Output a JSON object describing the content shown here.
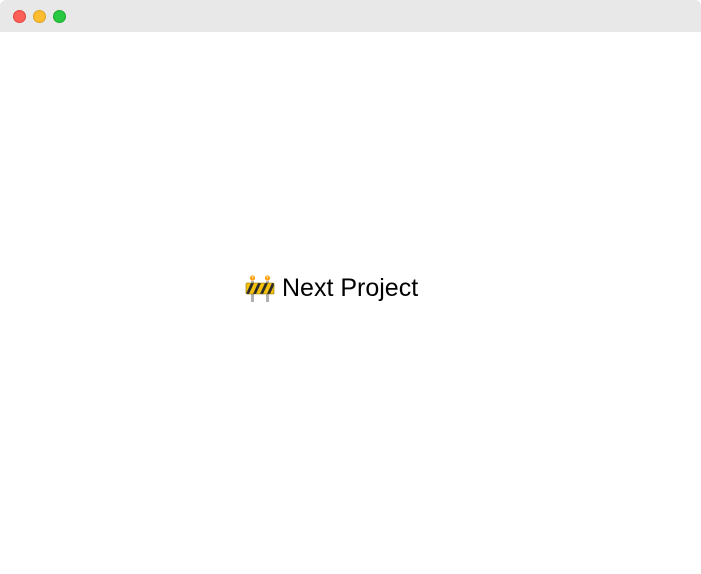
{
  "window": {
    "controls": [
      "close",
      "minimize",
      "maximize"
    ]
  },
  "main": {
    "icon": "construction-barrier-icon",
    "title": "Next Project"
  },
  "colors": {
    "close": "#ff5f57",
    "minimize": "#febc2e",
    "maximize": "#28c840",
    "titlebar": "#e8e8e8",
    "background": "#ffffff"
  }
}
